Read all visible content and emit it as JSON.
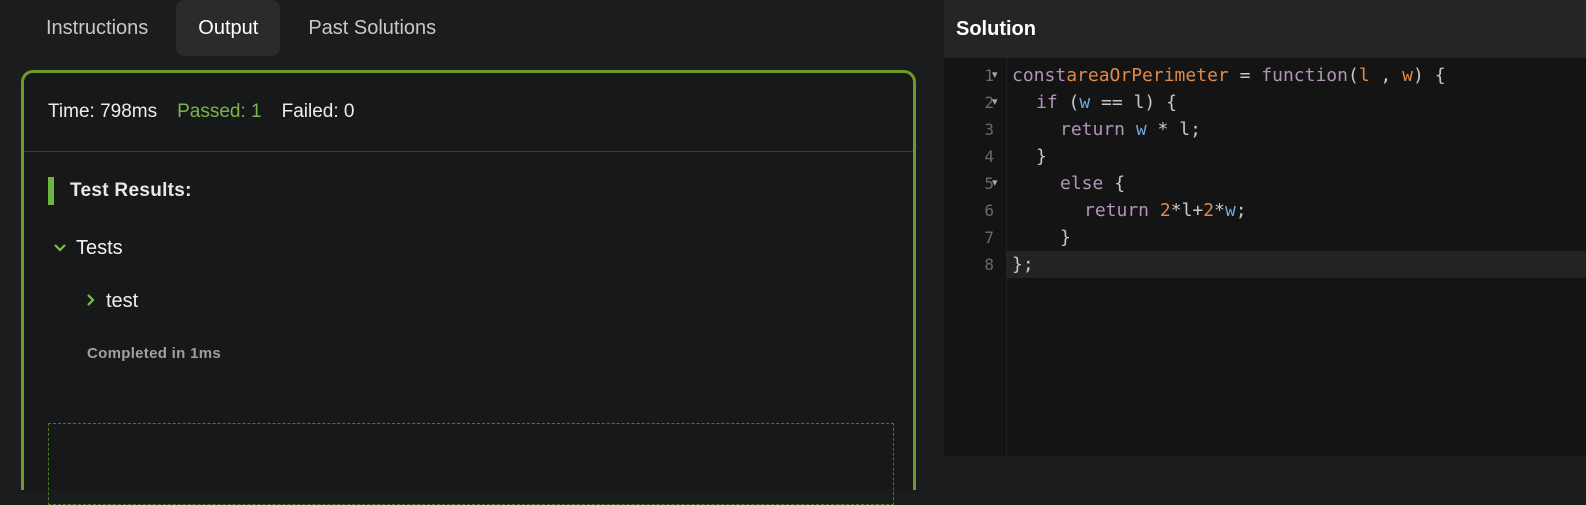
{
  "tabs": [
    {
      "label": "Instructions",
      "active": false
    },
    {
      "label": "Output",
      "active": true
    },
    {
      "label": "Past Solutions",
      "active": false
    }
  ],
  "summary": {
    "time": "Time: 798ms",
    "passed": "Passed: 1",
    "failed": "Failed: 0"
  },
  "results": {
    "title": "Test Results:",
    "group_label": "Tests",
    "test_label": "test",
    "completed": "Completed in 1ms"
  },
  "solution": {
    "header": "Solution",
    "lines": [
      {
        "n": "1",
        "fold": true
      },
      {
        "n": "2",
        "fold": true
      },
      {
        "n": "3",
        "fold": false
      },
      {
        "n": "4",
        "fold": false
      },
      {
        "n": "5",
        "fold": true
      },
      {
        "n": "6",
        "fold": false
      },
      {
        "n": "7",
        "fold": false
      },
      {
        "n": "8",
        "fold": false
      }
    ],
    "code": {
      "l1": {
        "kw1": "const",
        "name": "areaOrPerimeter",
        "eq": " = ",
        "fkw": "function",
        "open": "(",
        "p1": "l",
        "sep": " , ",
        "p2": "w",
        "close": ") {"
      },
      "l2": {
        "kw": "if",
        "pre": " (",
        "a": "w",
        "mid": " == ",
        "b": "l",
        "post": ") {"
      },
      "l3": {
        "kw": "return",
        "a": " w",
        "mid": " * ",
        "b": "l",
        "post": ";"
      },
      "l4": {
        "text": "}"
      },
      "l5": {
        "kw": "else",
        "post": " {"
      },
      "l6": {
        "kw": "return",
        "n1": " 2",
        "s1": "*",
        "v1": "l",
        "s2": "+",
        "n2": "2",
        "s3": "*",
        "v2": "w",
        "post": ";"
      },
      "l7": {
        "text": "}"
      },
      "l8": {
        "text": "};"
      }
    }
  },
  "colors": {
    "accent_green": "#6d9a2b",
    "passed_green": "#79b54a"
  }
}
